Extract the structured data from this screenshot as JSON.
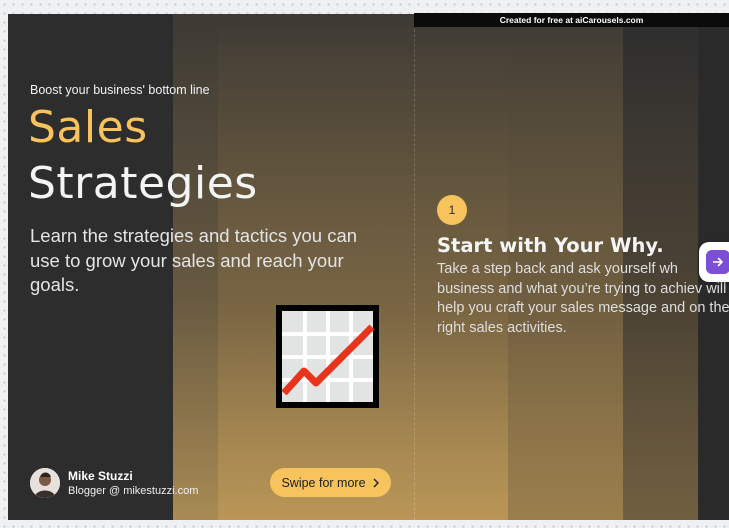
{
  "banner": {
    "text": "Created for free at aiCarousels.com"
  },
  "slide1": {
    "kicker": "Boost your business' bottom line",
    "title_line1": "Sales",
    "title_line2": "Strategies",
    "subtitle": "Learn the strategies and tactics you can use to grow your sales and reach your goals.",
    "emoji": "chart-increasing-icon",
    "author_name": "Mike Stuzzi",
    "author_role": "Blogger @ mikestuzzi.com",
    "swipe_label": "Swipe for more"
  },
  "slide2": {
    "step_number": "1",
    "step_title": "Start with Your Why.",
    "step_body": "Take a step back and ask yourself wh business and what you’re trying to achiev will help you craft your sales message and on the right sales activities."
  },
  "controls": {
    "next_icon": "arrow-right-icon"
  },
  "colors": {
    "accent": "#f6c35c",
    "background": "#2d2d2e",
    "next_button": "#7a4fd6",
    "chart_line": "#e8341c"
  }
}
